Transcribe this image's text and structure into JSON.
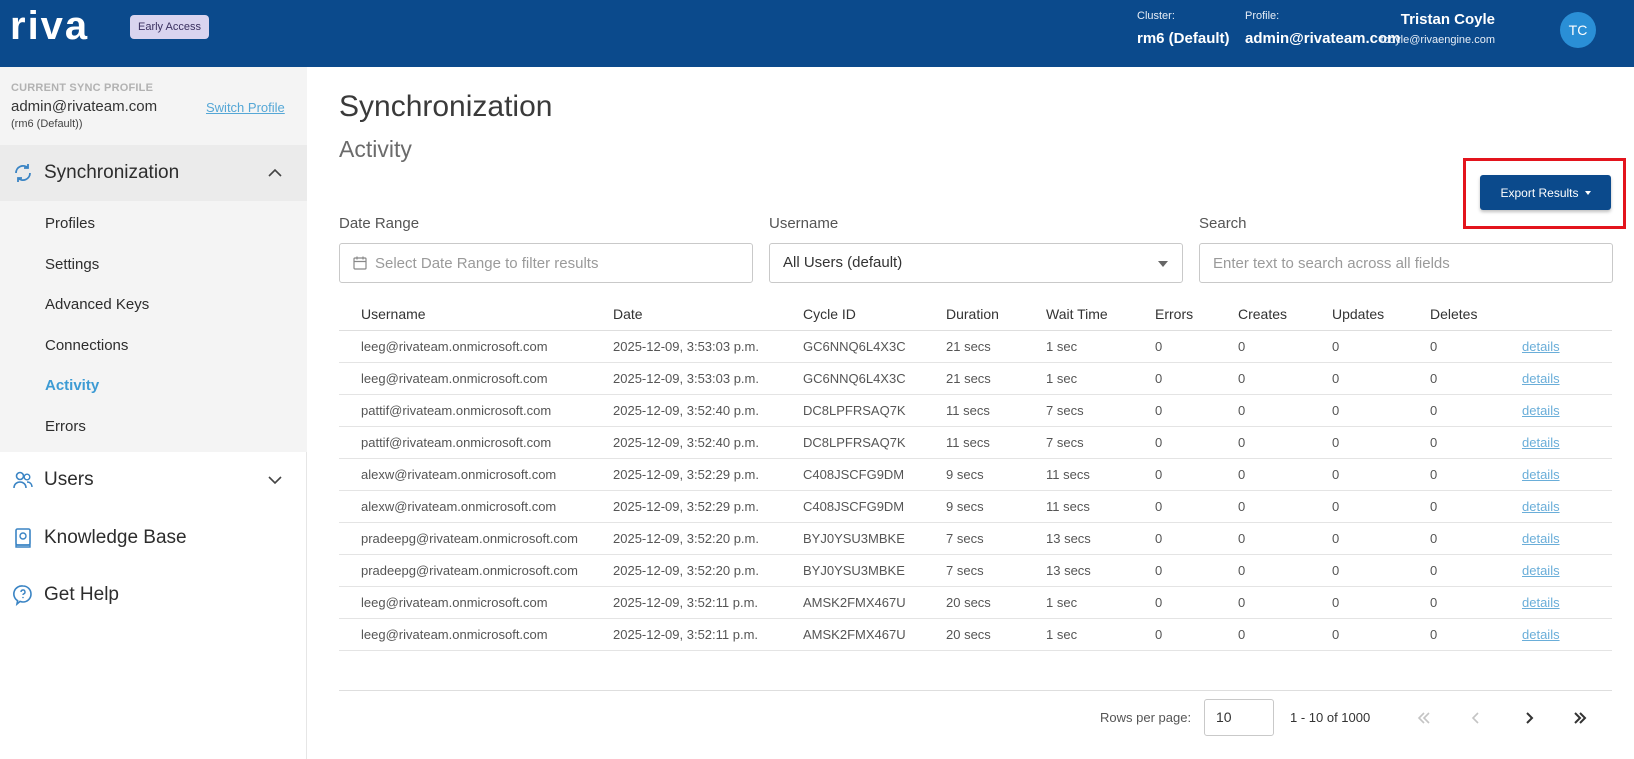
{
  "header": {
    "logo_text": "riva",
    "badge": "Early Access",
    "cluster_label": "Cluster:",
    "cluster_value": "rm6 (Default)",
    "profile_label": "Profile:",
    "profile_value": "admin@rivateam.com",
    "user_name": "Tristan Coyle",
    "user_email": "tcoyle@rivaengine.com",
    "avatar_initials": "TC",
    "bar_color": "#0b4a8c"
  },
  "sidebar": {
    "profile_caption": "CURRENT SYNC PROFILE",
    "profile_email": "admin@rivateam.com",
    "profile_cluster": "(rm6 (Default))",
    "switch_profile": "Switch Profile",
    "sections": [
      {
        "label": "Synchronization",
        "icon": "sync-icon",
        "expanded": true
      },
      {
        "label": "Users",
        "icon": "users-icon",
        "expanded": false
      },
      {
        "label": "Knowledge Base",
        "icon": "book-icon"
      },
      {
        "label": "Get Help",
        "icon": "help-icon"
      }
    ],
    "sync_items": [
      "Profiles",
      "Settings",
      "Advanced Keys",
      "Connections",
      "Activity",
      "Errors"
    ],
    "active_item": "Activity",
    "active_color": "#3d9bd4"
  },
  "main": {
    "title": "Synchronization",
    "subtitle": "Activity",
    "export_button": "Export Results",
    "filters": {
      "date_range_label": "Date Range",
      "date_range_placeholder": "Select Date Range to filter results",
      "username_label": "Username",
      "username_value": "All Users (default)",
      "search_label": "Search",
      "search_placeholder": "Enter text to search across all fields"
    },
    "table": {
      "columns": [
        "Username",
        "Date",
        "Cycle ID",
        "Duration",
        "Wait Time",
        "Errors",
        "Creates",
        "Updates",
        "Deletes",
        ""
      ],
      "details_label": "details",
      "rows": [
        [
          "leeg@rivateam.onmicrosoft.com",
          "2025-12-09, 3:53:03 p.m.",
          "GC6NNQ6L4X3C",
          "21 secs",
          "1 sec",
          "0",
          "0",
          "0",
          "0"
        ],
        [
          "leeg@rivateam.onmicrosoft.com",
          "2025-12-09, 3:53:03 p.m.",
          "GC6NNQ6L4X3C",
          "21 secs",
          "1 sec",
          "0",
          "0",
          "0",
          "0"
        ],
        [
          "pattif@rivateam.onmicrosoft.com",
          "2025-12-09, 3:52:40 p.m.",
          "DC8LPFRSAQ7K",
          "11 secs",
          "7 secs",
          "0",
          "0",
          "0",
          "0"
        ],
        [
          "pattif@rivateam.onmicrosoft.com",
          "2025-12-09, 3:52:40 p.m.",
          "DC8LPFRSAQ7K",
          "11 secs",
          "7 secs",
          "0",
          "0",
          "0",
          "0"
        ],
        [
          "alexw@rivateam.onmicrosoft.com",
          "2025-12-09, 3:52:29 p.m.",
          "C408JSCFG9DM",
          "9 secs",
          "11 secs",
          "0",
          "0",
          "0",
          "0"
        ],
        [
          "alexw@rivateam.onmicrosoft.com",
          "2025-12-09, 3:52:29 p.m.",
          "C408JSCFG9DM",
          "9 secs",
          "11 secs",
          "0",
          "0",
          "0",
          "0"
        ],
        [
          "pradeepg@rivateam.onmicrosoft.com",
          "2025-12-09, 3:52:20 p.m.",
          "BYJ0YSU3MBKE",
          "7 secs",
          "13 secs",
          "0",
          "0",
          "0",
          "0"
        ],
        [
          "pradeepg@rivateam.onmicrosoft.com",
          "2025-12-09, 3:52:20 p.m.",
          "BYJ0YSU3MBKE",
          "7 secs",
          "13 secs",
          "0",
          "0",
          "0",
          "0"
        ],
        [
          "leeg@rivateam.onmicrosoft.com",
          "2025-12-09, 3:52:11 p.m.",
          "AMSK2FMX467U",
          "20 secs",
          "1 sec",
          "0",
          "0",
          "0",
          "0"
        ],
        [
          "leeg@rivateam.onmicrosoft.com",
          "2025-12-09, 3:52:11 p.m.",
          "AMSK2FMX467U",
          "20 secs",
          "1 sec",
          "0",
          "0",
          "0",
          "0"
        ]
      ]
    },
    "pagination": {
      "rows_label": "Rows per page:",
      "rows_value": "10",
      "range": "1 - 10 of 1000",
      "first_icon": "«",
      "prev_icon": "‹",
      "next_icon": "›",
      "last_icon": "»"
    },
    "highlight_color": "#e3141d"
  }
}
